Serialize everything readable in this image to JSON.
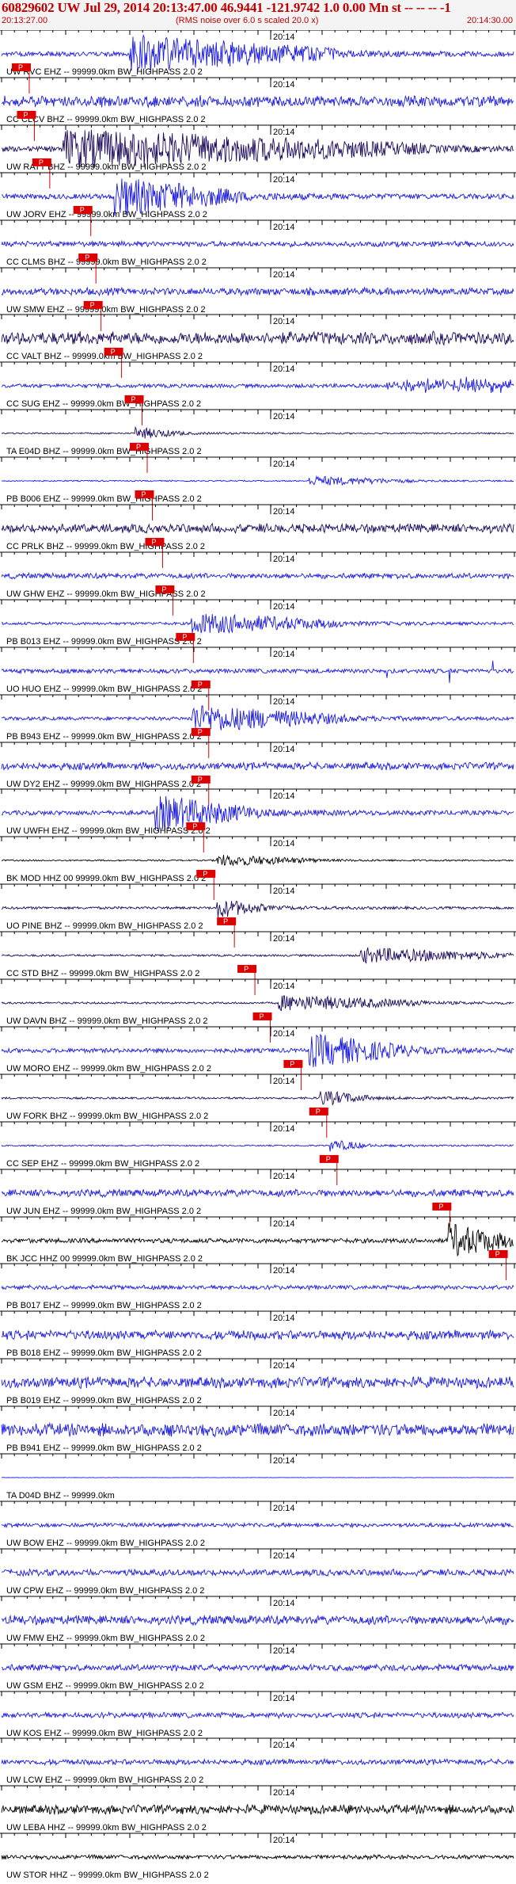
{
  "header": {
    "title": "60829602 UW Jul 29, 2014 20:13:47.00   46.9441 -121.9742  1.0 0.00 Mn st -- -- --  -1",
    "start_time": "20:13:27.00",
    "noise_note": "(RMS noise over 6.0 s scaled 20.0 x)",
    "end_time": "20:14:30.00"
  },
  "time_mark_label": "20:14",
  "pick_label": "P",
  "colors": {
    "blue": "#1a1ae6",
    "navy": "#1c0a5c",
    "black": "#000000",
    "pick": "#dd0000",
    "text": "#000000"
  },
  "traces": [
    {
      "label": "UW RVC EHZ -- 99999.0km BW_HIGHPASS  2.0  2",
      "color": "blue",
      "amp": 0.95,
      "type": "event",
      "pick": 0.02,
      "ev": 0.25,
      "dur": 0.4
    },
    {
      "label": "CC CLCV BHZ -- 99999.0km BW_HIGHPASS  2.0  2",
      "color": "blue",
      "amp": 0.3,
      "type": "noise",
      "pick": 0.03,
      "ev": 0.3,
      "dur": 0.3
    },
    {
      "label": "UW RATT BHZ -- 99999.0km BW_HIGHPASS  2.0  2",
      "color": "navy",
      "amp": 1.0,
      "type": "clip",
      "pick": 0.06,
      "ev": 0.12,
      "dur": 0.7
    },
    {
      "label": "UW JORV EHZ -- 99999.0km BW_HIGHPASS  2.0  2",
      "color": "blue",
      "amp": 1.0,
      "type": "event",
      "pick": 0.14,
      "ev": 0.22,
      "dur": 0.25
    },
    {
      "label": "CC CLMS BHZ -- 99999.0km BW_HIGHPASS  2.0  2",
      "color": "blue",
      "amp": 0.15,
      "type": "noise",
      "pick": 0.15
    },
    {
      "label": "UW SMW EHZ -- 99999.0km BW_HIGHPASS  2.0  2",
      "color": "blue",
      "amp": 0.2,
      "type": "noise",
      "pick": 0.16
    },
    {
      "label": "CC VALT BHZ -- 99999.0km BW_HIGHPASS  2.0  2",
      "color": "navy",
      "amp": 0.35,
      "type": "noise",
      "pick": 0.2
    },
    {
      "label": "CC SUG EHZ -- 99999.0km BW_HIGHPASS  2.0  2",
      "color": "blue",
      "amp": 0.3,
      "type": "burst",
      "pick": 0.24,
      "burst": 0.75
    },
    {
      "label": "TA E04D BHZ -- 99999.0km BW_HIGHPASS  2.0  2",
      "color": "navy",
      "amp": 0.3,
      "type": "event",
      "pick": 0.25,
      "ev": 0.26,
      "dur": 0.1
    },
    {
      "label": "PB B006 EHZ -- 99999.0km BW_HIGHPASS  2.0  2",
      "color": "blue",
      "amp": 0.25,
      "type": "event",
      "pick": 0.26,
      "ev": 0.6,
      "dur": 0.2
    },
    {
      "label": "CC PRLK BHZ -- 99999.0km BW_HIGHPASS  2.0  2",
      "color": "navy",
      "amp": 0.25,
      "type": "noise",
      "pick": 0.28
    },
    {
      "label": "UW GHW EHZ -- 99999.0km BW_HIGHPASS  2.0  2",
      "color": "blue",
      "amp": 0.15,
      "type": "noise",
      "pick": 0.3
    },
    {
      "label": "PB B013 EHZ -- 99999.0km BW_HIGHPASS  2.0  2",
      "color": "blue",
      "amp": 0.55,
      "type": "event",
      "pick": 0.34,
      "ev": 0.37,
      "dur": 0.3
    },
    {
      "label": "UO HUO EHZ -- 99999.0km BW_HIGHPASS  2.0  2",
      "color": "blue",
      "amp": 0.6,
      "type": "spikes",
      "pick": 0.37
    },
    {
      "label": "PB B943 EHZ -- 99999.0km BW_HIGHPASS  2.0  2",
      "color": "blue",
      "amp": 0.7,
      "type": "event",
      "pick": 0.37,
      "ev": 0.37,
      "dur": 0.3
    },
    {
      "label": "UW DY2 EHZ -- 99999.0km BW_HIGHPASS  2.0  2",
      "color": "blue",
      "amp": 0.2,
      "type": "noise",
      "pick": 0.37
    },
    {
      "label": "UW UWFH EHZ -- 99999.0km BW_HIGHPASS  2.0  2",
      "color": "blue",
      "amp": 0.9,
      "type": "event",
      "pick": 0.36,
      "ev": 0.3,
      "dur": 0.2
    },
    {
      "label": "BK MOD HHZ 00 99999.0km BW_HIGHPASS  2.0  2",
      "color": "black",
      "amp": 0.3,
      "type": "event",
      "pick": 0.38,
      "ev": 0.42,
      "dur": 0.2
    },
    {
      "label": "UO PINE BHZ -- 99999.0km BW_HIGHPASS  2.0  2",
      "color": "navy",
      "amp": 0.5,
      "type": "event",
      "pick": 0.42,
      "ev": 0.42,
      "dur": 0.1
    },
    {
      "label": "CC STD BHZ -- 99999.0km BW_HIGHPASS  2.0  2",
      "color": "navy",
      "amp": 0.4,
      "type": "event",
      "pick": 0.46,
      "ev": 0.7,
      "dur": 0.3
    },
    {
      "label": "UW DAVN BHZ -- 99999.0km BW_HIGHPASS  2.0  2",
      "color": "navy",
      "amp": 0.4,
      "type": "event",
      "pick": 0.49,
      "ev": 0.54,
      "dur": 0.3
    },
    {
      "label": "UW MORO EHZ -- 99999.0km BW_HIGHPASS  2.0  2",
      "color": "blue",
      "amp": 0.85,
      "type": "event",
      "pick": 0.55,
      "ev": 0.6,
      "dur": 0.2
    },
    {
      "label": "UW FORK BHZ -- 99999.0km BW_HIGHPASS  2.0  2",
      "color": "navy",
      "amp": 0.4,
      "type": "event",
      "pick": 0.6,
      "ev": 0.62,
      "dur": 0.1
    },
    {
      "label": "CC SEP EHZ -- 99999.0km BW_HIGHPASS  2.0  2",
      "color": "blue",
      "amp": 0.3,
      "type": "event",
      "pick": 0.62,
      "ev": 0.64,
      "dur": 0.08
    },
    {
      "label": "UW JUN EHZ -- 99999.0km BW_HIGHPASS  2.0  2",
      "color": "blue",
      "amp": 0.2,
      "type": "noise",
      "pick": 0.84
    },
    {
      "label": "BK JCC HHZ 00 99999.0km BW_HIGHPASS  2.0  2",
      "color": "black",
      "amp": 0.9,
      "type": "event",
      "pick": 0.95,
      "ev": 0.87,
      "dur": 0.13
    },
    {
      "label": "PB B017 EHZ -- 99999.0km BW_HIGHPASS  2.0  2",
      "color": "blue",
      "amp": 0.12,
      "type": "noise"
    },
    {
      "label": "PB B018 EHZ -- 99999.0km BW_HIGHPASS  2.0  2",
      "color": "blue",
      "amp": 0.25,
      "type": "noise"
    },
    {
      "label": "PB B019 EHZ -- 99999.0km BW_HIGHPASS  2.0  2",
      "color": "blue",
      "amp": 0.3,
      "type": "noise"
    },
    {
      "label": "PB B941 EHZ -- 99999.0km BW_HIGHPASS  2.0  2",
      "color": "blue",
      "amp": 0.35,
      "type": "noise"
    },
    {
      "label": "TA D04D BHZ -- 99999.0km",
      "color": "blue",
      "amp": 0.0,
      "type": "flat"
    },
    {
      "label": "UW BOW EHZ -- 99999.0km BW_HIGHPASS  2.0  2",
      "color": "blue",
      "amp": 0.12,
      "type": "noise"
    },
    {
      "label": "UW CPW EHZ -- 99999.0km BW_HIGHPASS  2.0  2",
      "color": "blue",
      "amp": 0.18,
      "type": "noise"
    },
    {
      "label": "UW FMW EHZ -- 99999.0km BW_HIGHPASS  2.0  2",
      "color": "blue",
      "amp": 0.25,
      "type": "noise"
    },
    {
      "label": "UW GSM EHZ -- 99999.0km BW_HIGHPASS  2.0  2",
      "color": "blue",
      "amp": 0.18,
      "type": "noise"
    },
    {
      "label": "UW KOS EHZ -- 99999.0km BW_HIGHPASS  2.0  2",
      "color": "blue",
      "amp": 0.15,
      "type": "noise"
    },
    {
      "label": "UW LCW EHZ -- 99999.0km BW_HIGHPASS  2.0  2",
      "color": "blue",
      "amp": 0.15,
      "type": "noise"
    },
    {
      "label": "UW LEBA HHZ -- 99999.0km BW_HIGHPASS  2.0  2",
      "color": "black",
      "amp": 0.25,
      "type": "noise"
    },
    {
      "label": "UW STOR HHZ -- 99999.0km BW_HIGHPASS  2.0  2",
      "color": "black",
      "amp": 0.12,
      "type": "noise"
    }
  ]
}
